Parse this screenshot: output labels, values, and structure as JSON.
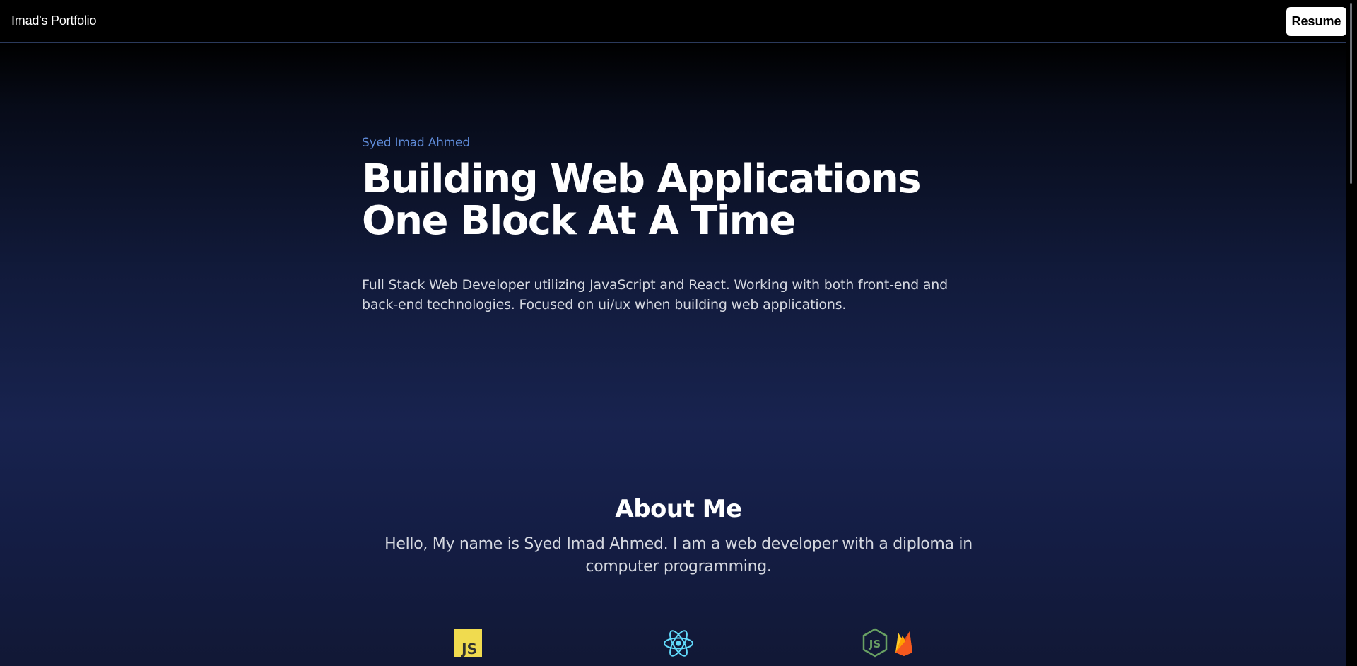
{
  "navbar": {
    "brand": "Imad's Portfolio",
    "resume_label": "Resume"
  },
  "hero": {
    "name": "Syed Imad Ahmed",
    "title_line1": "Building Web Applications",
    "title_line2": "One Block At A Time",
    "description": "Full Stack Web Developer utilizing JavaScript and React. Working with both front-end and back-end technologies. Focused on ui/ux when building web applications."
  },
  "about": {
    "heading": "About Me",
    "text": "Hello, My name is Syed Imad Ahmed. I am a web developer with a diploma in computer programming."
  },
  "skills": [
    {
      "icon": "javascript-icon",
      "label": "JS",
      "color": "#f0db4f"
    },
    {
      "icon": "react-icon",
      "color": "#61dafb"
    },
    {
      "icon": "nodejs-icon",
      "label": "JS",
      "color": "#68a063"
    },
    {
      "icon": "firebase-icon",
      "color": "#f58220"
    }
  ]
}
